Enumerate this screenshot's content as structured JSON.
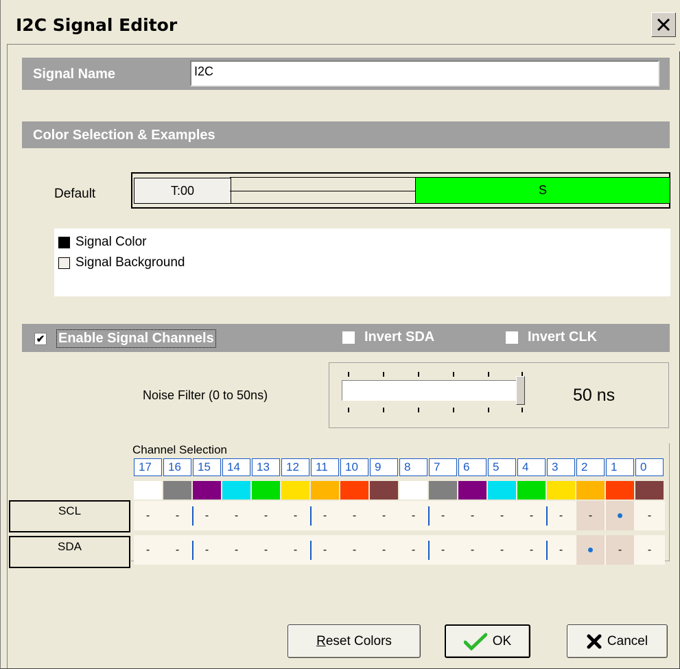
{
  "window": {
    "title": "I2C Signal Editor",
    "close_glyph": "✕"
  },
  "signal_name": {
    "label": "Signal Name",
    "value": "I2C"
  },
  "color_section": {
    "label": "Color Selection & Examples"
  },
  "preview": {
    "row_label": "Default",
    "time_label": "T:00",
    "state_label": "S",
    "state_color": "#00ff00"
  },
  "legend": {
    "signal_color": "Signal Color",
    "signal_background": "Signal Background"
  },
  "channels": {
    "enable_label": "Enable Signal Channels",
    "enable_checked": true,
    "invert_sda_label": "Invert SDA",
    "invert_clk_label": "Invert CLK"
  },
  "noise_filter": {
    "label": "Noise Filter  (0 to 50ns)",
    "value_text": "50 ns",
    "level": 1.0
  },
  "channel_selection": {
    "title": "Channel Selection",
    "numbers": [
      "17",
      "16",
      "15",
      "14",
      "13",
      "12",
      "11",
      "10",
      "9",
      "8",
      "7",
      "6",
      "5",
      "4",
      "3",
      "2",
      "1",
      "0"
    ],
    "colors": [
      "#ffffff",
      "#808080",
      "#800080",
      "#00e0f0",
      "#00dd00",
      "#ffe000",
      "#ffb400",
      "#ff4000",
      "#804040",
      "#ffffff",
      "#808080",
      "#800080",
      "#00e0f0",
      "#00dd00",
      "#ffe000",
      "#ffb400",
      "#ff4000",
      "#804040"
    ],
    "rows": [
      {
        "label": "SCL",
        "cells": [
          "-",
          "-",
          "-",
          "-",
          "-",
          "-",
          "-",
          "-",
          "-",
          "-",
          "-",
          "-",
          "-",
          "-",
          "-",
          "-",
          "•",
          "-"
        ]
      },
      {
        "label": "SDA",
        "cells": [
          "-",
          "-",
          "-",
          "-",
          "-",
          "-",
          "-",
          "-",
          "-",
          "-",
          "-",
          "-",
          "-",
          "-",
          "-",
          "•",
          "-",
          "-"
        ]
      }
    ]
  },
  "buttons": {
    "reset": "Reset Colors",
    "reset_mnemonic": "R",
    "reset_rest": "eset Colors",
    "ok": "OK",
    "cancel": "Cancel"
  }
}
